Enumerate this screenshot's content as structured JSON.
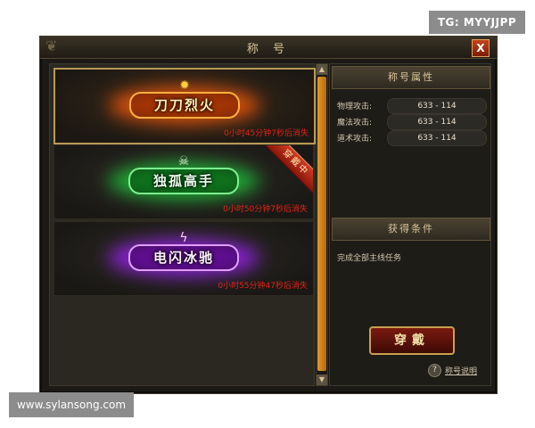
{
  "watermarks": {
    "tg": "TG: MYYJJPP",
    "site": "www.sylansong.com"
  },
  "window": {
    "title": "称 号",
    "close_label": "X"
  },
  "titles": [
    {
      "name": "刀刀烈火",
      "expire": "0小时45分钟7秒后消失",
      "theme": "fire",
      "selected": true,
      "icon": "flame-icon"
    },
    {
      "name": "独孤高手",
      "expire": "0小时50分钟7秒后消失",
      "theme": "green",
      "worn_badge": "穿戴中",
      "icon": "skull-icon"
    },
    {
      "name": "电闪冰驰",
      "expire": "0小时55分钟47秒后消失",
      "theme": "purple",
      "icon": "lightning-icon"
    }
  ],
  "attributes": {
    "heading": "称号属性",
    "rows": [
      {
        "label": "物理攻击:",
        "value": "633 - 114"
      },
      {
        "label": "魔法攻击:",
        "value": "633 - 114"
      },
      {
        "label": "道术攻击:",
        "value": "633 - 114"
      }
    ]
  },
  "conditions": {
    "heading": "获得条件",
    "text": "完成全部主线任务"
  },
  "actions": {
    "wear_label": "穿戴",
    "help_label": "称号说明"
  },
  "colors": {
    "fire": "#ff7a18",
    "green": "#2fd84a",
    "purple": "#b440ff",
    "expire_text": "#e0241a",
    "gold": "#d8c49a"
  }
}
